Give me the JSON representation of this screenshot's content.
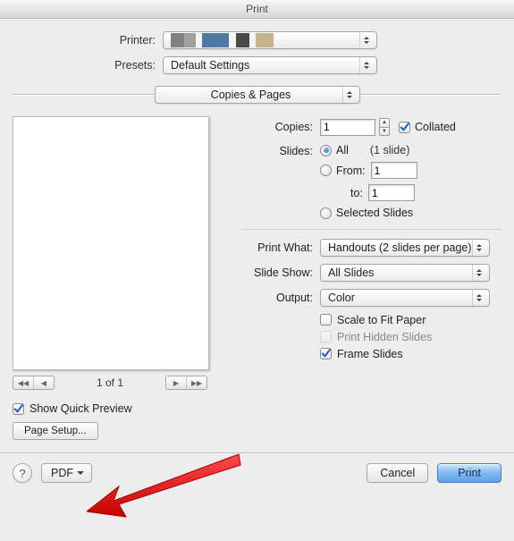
{
  "title": "Print",
  "labels": {
    "printer": "Printer:",
    "presets": "Presets:"
  },
  "presets_value": "Default Settings",
  "section_popup": "Copies & Pages",
  "preview": {
    "page_indicator": "1 of 1",
    "show_quick_preview": "Show Quick Preview",
    "page_setup": "Page Setup..."
  },
  "options": {
    "copies_label": "Copies:",
    "copies_value": "1",
    "collated": "Collated",
    "slides_label": "Slides:",
    "radio_all": "All",
    "slide_count_hint": "(1 slide)",
    "radio_from": "From:",
    "from_value": "1",
    "to_label": "to:",
    "to_value": "1",
    "radio_selected": "Selected Slides",
    "print_what_label": "Print What:",
    "print_what_value": "Handouts (2 slides per page)",
    "slide_show_label": "Slide Show:",
    "slide_show_value": "All Slides",
    "output_label": "Output:",
    "output_value": "Color",
    "scale_to_fit": "Scale to Fit Paper",
    "print_hidden": "Print Hidden Slides",
    "frame_slides": "Frame Slides"
  },
  "footer": {
    "pdf": "PDF",
    "cancel": "Cancel",
    "print": "Print"
  }
}
